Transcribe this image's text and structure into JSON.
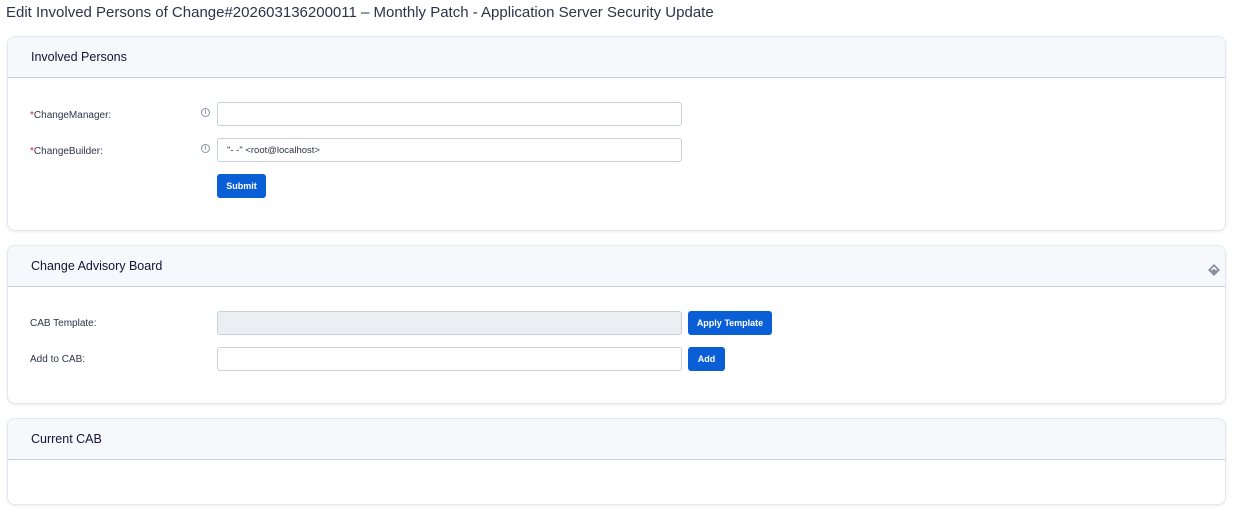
{
  "page": {
    "title": "Edit Involved Persons of Change#202603136200011 – Monthly Patch - Application Server Security Update"
  },
  "involved_persons": {
    "title": "Involved Persons",
    "change_manager": {
      "required_mark": "*",
      "label": "ChangeManager:",
      "info_icon": "info-icon",
      "value": "",
      "placeholder": ""
    },
    "change_builder": {
      "required_mark": "*",
      "label": "ChangeBuilder:",
      "info_icon": "info-icon",
      "value": "\"- -\" <root@localhost>"
    },
    "submit_label": "Submit"
  },
  "cab": {
    "title": "Change Advisory Board",
    "toggle_icon": "collapse-toggle-icon",
    "template": {
      "label": "CAB Template:",
      "value": "",
      "button_label": "Apply Template"
    },
    "add": {
      "label": "Add to CAB:",
      "value": "",
      "button_label": "Add"
    }
  },
  "current_cab": {
    "title": "Current CAB"
  },
  "colors": {
    "primary_button": "#0a5fd6",
    "required": "#d02040",
    "header_bg": "#f6f8fc"
  }
}
